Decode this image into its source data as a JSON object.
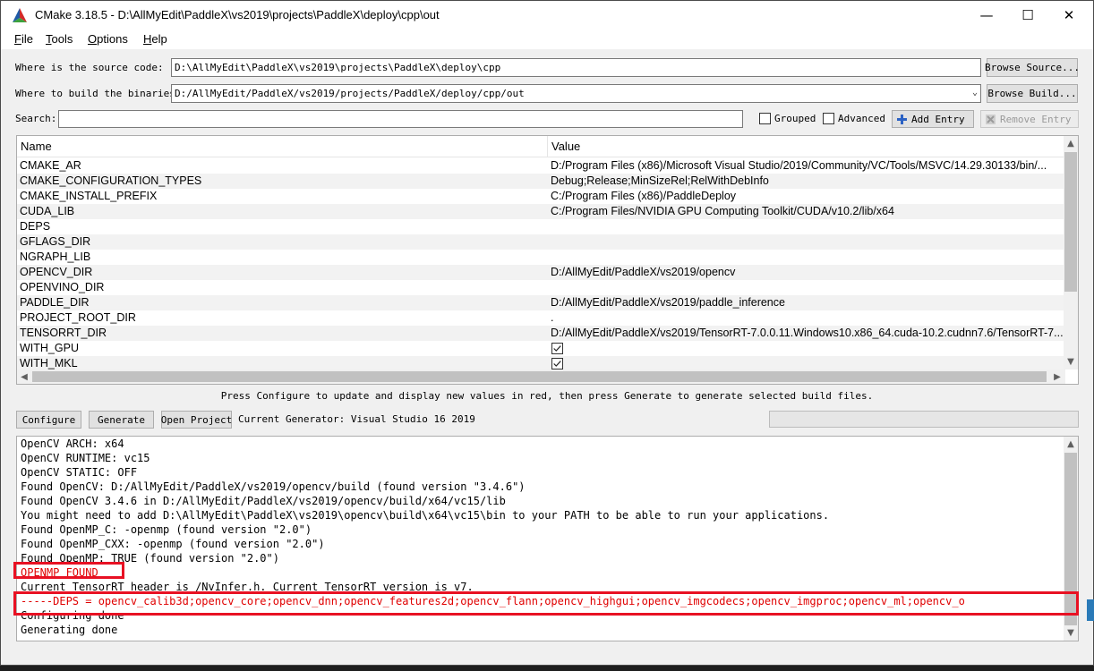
{
  "titlebar": {
    "title": "CMake 3.18.5 - D:\\AllMyEdit\\PaddleX\\vs2019\\projects\\PaddleX\\deploy\\cpp\\out",
    "minimize": "—",
    "maximize": "☐",
    "close": "✕"
  },
  "menu": [
    {
      "label": "File",
      "mnemonic": "F",
      "rest": "ile"
    },
    {
      "label": "Tools",
      "mnemonic": "T",
      "rest": "ools"
    },
    {
      "label": "Options",
      "mnemonic": "O",
      "rest": "ptions"
    },
    {
      "label": "Help",
      "mnemonic": "H",
      "rest": "elp"
    }
  ],
  "source": {
    "label": "Where is the source code:",
    "value": "D:\\AllMyEdit\\PaddleX\\vs2019\\projects\\PaddleX\\deploy\\cpp",
    "browse": "Browse Source..."
  },
  "build": {
    "label": "Where to build the binaries:",
    "value": "D:/AllMyEdit/PaddleX/vs2019/projects/PaddleX/deploy/cpp/out",
    "browse": "Browse Build..."
  },
  "search": {
    "label": "Search:",
    "value": "",
    "grouped": "Grouped",
    "advanced": "Advanced",
    "add_entry": "Add Entry",
    "remove_entry": "Remove Entry"
  },
  "table": {
    "headers": [
      "Name",
      "Value"
    ],
    "rows": [
      {
        "name": "CMAKE_AR",
        "value": "D:/Program Files (x86)/Microsoft Visual Studio/2019/Community/VC/Tools/MSVC/14.29.30133/bin/...",
        "type": "text"
      },
      {
        "name": "CMAKE_CONFIGURATION_TYPES",
        "value": "Debug;Release;MinSizeRel;RelWithDebInfo",
        "type": "text"
      },
      {
        "name": "CMAKE_INSTALL_PREFIX",
        "value": "C:/Program Files (x86)/PaddleDeploy",
        "type": "text"
      },
      {
        "name": "CUDA_LIB",
        "value": "C:/Program Files/NVIDIA GPU Computing Toolkit/CUDA/v10.2/lib/x64",
        "type": "text"
      },
      {
        "name": "DEPS",
        "value": "",
        "type": "text"
      },
      {
        "name": "GFLAGS_DIR",
        "value": "",
        "type": "text"
      },
      {
        "name": "NGRAPH_LIB",
        "value": "",
        "type": "text"
      },
      {
        "name": "OPENCV_DIR",
        "value": "D:/AllMyEdit/PaddleX/vs2019/opencv",
        "type": "text"
      },
      {
        "name": "OPENVINO_DIR",
        "value": "",
        "type": "text"
      },
      {
        "name": "PADDLE_DIR",
        "value": "D:/AllMyEdit/PaddleX/vs2019/paddle_inference",
        "type": "text"
      },
      {
        "name": "PROJECT_ROOT_DIR",
        "value": ".",
        "type": "text"
      },
      {
        "name": "TENSORRT_DIR",
        "value": "D:/AllMyEdit/PaddleX/vs2019/TensorRT-7.0.0.11.Windows10.x86_64.cuda-10.2.cudnn7.6/TensorRT-7...",
        "type": "text"
      },
      {
        "name": "WITH_GPU",
        "value": "",
        "type": "checkbox",
        "checked": true
      },
      {
        "name": "WITH_MKL",
        "value": "",
        "type": "checkbox",
        "checked": true
      }
    ]
  },
  "hint": "Press Configure to update and display new values in red, then press Generate to generate selected build files.",
  "actions": {
    "configure": "Configure",
    "generate": "Generate",
    "open_project": "Open Project",
    "generator": "Current Generator: Visual Studio 16 2019"
  },
  "output": {
    "lines": [
      {
        "text": "OpenCV ARCH: x64",
        "red": false
      },
      {
        "text": "OpenCV RUNTIME: vc15",
        "red": false
      },
      {
        "text": "OpenCV STATIC: OFF",
        "red": false
      },
      {
        "text": "Found OpenCV: D:/AllMyEdit/PaddleX/vs2019/opencv/build (found version \"3.4.6\")",
        "red": false
      },
      {
        "text": "Found OpenCV 3.4.6 in D:/AllMyEdit/PaddleX/vs2019/opencv/build/x64/vc15/lib",
        "red": false
      },
      {
        "text": "You might need to add D:\\AllMyEdit\\PaddleX\\vs2019\\opencv\\build\\x64\\vc15\\bin to your PATH to be able to run your applications.",
        "red": false
      },
      {
        "text": "Found OpenMP_C: -openmp (found version \"2.0\")",
        "red": false
      },
      {
        "text": "Found OpenMP_CXX: -openmp (found version \"2.0\")",
        "red": false
      },
      {
        "text": "Found OpenMP: TRUE (found version \"2.0\")",
        "red": false
      },
      {
        "text": "OPENMP_FOUND",
        "red": true
      },
      {
        "text": "Current TensorRT header is /NvInfer.h. Current TensorRT version is v7.",
        "red": false
      },
      {
        "text": "-----DEPS = opencv_calib3d;opencv_core;opencv_dnn;opencv_features2d;opencv_flann;opencv_highgui;opencv_imgcodecs;opencv_imgproc;opencv_ml;opencv_o",
        "red": true
      },
      {
        "text": "Configuring done",
        "red": false
      },
      {
        "text": "Generating done",
        "red": false
      }
    ]
  },
  "colors": {
    "red_text": "#e00000",
    "highlight_box": "#e81123"
  }
}
